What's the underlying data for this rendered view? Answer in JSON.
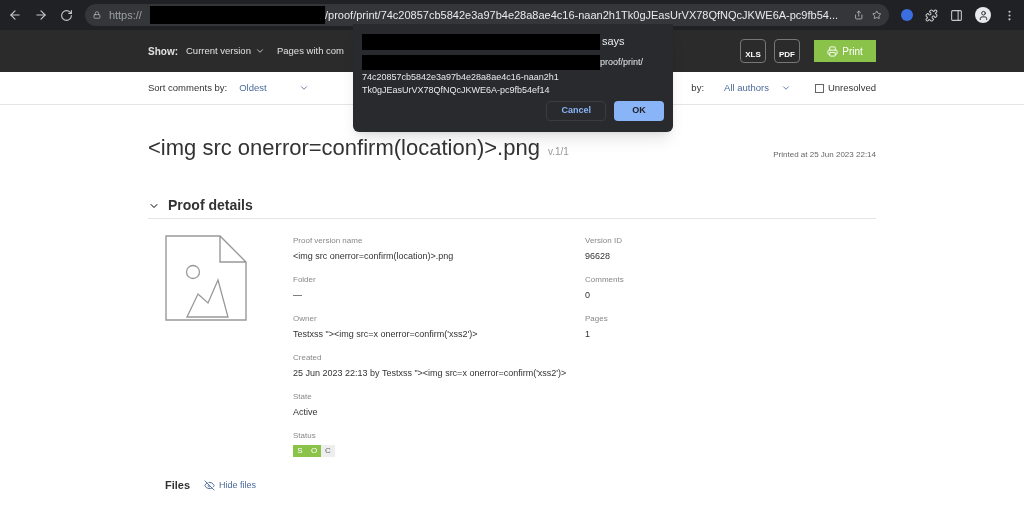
{
  "browser": {
    "url_prefix": "https://",
    "url_suffix": "/proof/print/74c20857cb5842e3a97b4e28a8ae4c16-naan2h1Tk0gJEasUrVX78QfNQcJKWE6A-pc9fb54..."
  },
  "toolbar": {
    "show_label": "Show:",
    "filters": [
      {
        "label": "Current version",
        "dropdown": true
      },
      {
        "label": "Pages with com",
        "dropdown": false
      }
    ],
    "export_buttons": [
      "XLS",
      "PDF"
    ],
    "print_button": "Print"
  },
  "filter_bar": {
    "sort_label": "Sort comments by:",
    "sort_value": "Oldest",
    "authors_label": "by:",
    "authors_value": "All authors",
    "unresolved": {
      "label": "Unresolved",
      "checked": false
    }
  },
  "header": {
    "title": "<img src onerror=confirm(location)>.png",
    "version": "v.1/1",
    "printed": "Printed at 25 Jun 2023 22:14"
  },
  "section": {
    "title": "Proof details",
    "expanded": true
  },
  "details_left": [
    {
      "label": "Proof version name",
      "value": "<img src onerror=confirm(location)>.png"
    },
    {
      "label": "Folder",
      "value": "—"
    },
    {
      "label": "Owner",
      "value": "Testxss \"><img src=x onerror=confirm('xss2')>"
    },
    {
      "label": "Created",
      "value": "25 Jun 2023 22:13 by Testxss \"><img src=x onerror=confirm('xss2')>"
    },
    {
      "label": "State",
      "value": "Active"
    }
  ],
  "status": {
    "label": "Status",
    "badges": [
      {
        "letter": "S",
        "active": true
      },
      {
        "letter": "O",
        "active": true
      },
      {
        "letter": "C",
        "active": false
      }
    ]
  },
  "details_right": [
    {
      "label": "Version ID",
      "value": "96628"
    },
    {
      "label": "Comments",
      "value": "0"
    },
    {
      "label": "Pages",
      "value": "1"
    }
  ],
  "files": {
    "title": "Files",
    "toggle": "Hide files"
  },
  "dialog": {
    "says": "says",
    "message_tail": "proof/print/",
    "message": "74c20857cb5842e3a97b4e28a8ae4c16-naan2h1Tk0gJEasUrVX78QfNQcJKWE6A-pc9fb54ef14",
    "buttons": [
      {
        "label": "Cancel",
        "primary": false
      },
      {
        "label": "OK",
        "primary": true
      }
    ]
  }
}
